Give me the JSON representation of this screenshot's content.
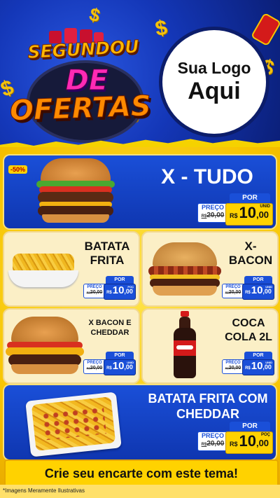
{
  "header": {
    "title_line1": "SEGUNDOU",
    "title_line2": "DE",
    "title_line3": "OFERTAS",
    "logo_line1": "Sua Logo",
    "logo_line2": "Aqui",
    "dollar_symbol": "$"
  },
  "products": [
    {
      "name": "X - TUDO",
      "badge": "-50%",
      "por": "POR",
      "preco_label": "PREÇO",
      "old_currency": "R$",
      "old_price": "20,00",
      "currency": "R$",
      "price_int": "10",
      "price_dec": ",00",
      "unit": "UNID"
    },
    {
      "name": "BATATA FRITA",
      "por": "POR",
      "preco_label": "PREÇO",
      "old_currency": "R$",
      "old_price": "20,00",
      "currency": "R$",
      "price_int": "10",
      "price_dec": ",00",
      "unit": "POÇ"
    },
    {
      "name": "X-BACON",
      "por": "POR",
      "preco_label": "PREÇO",
      "old_currency": "R$",
      "old_price": "20,00",
      "currency": "R$",
      "price_int": "10",
      "price_dec": ",00",
      "unit": "UNID"
    },
    {
      "name": "X BACON E CHEDDAR",
      "por": "POR",
      "preco_label": "PREÇO",
      "old_currency": "R$",
      "old_price": "20,00",
      "currency": "R$",
      "price_int": "10",
      "price_dec": ",00",
      "unit": "UNID"
    },
    {
      "name": "COCA COLA 2L",
      "por": "POR",
      "preco_label": "PREÇO",
      "old_currency": "R$",
      "old_price": "20,00",
      "currency": "R$",
      "price_int": "10",
      "price_dec": ",00",
      "unit": "UNID"
    },
    {
      "name": "BATATA FRITA COM CHEDDAR",
      "por": "POR",
      "preco_label": "PREÇO",
      "old_currency": "R$",
      "old_price": "20,00",
      "currency": "R$",
      "price_int": "10",
      "price_dec": ",00",
      "unit": "POÇ"
    }
  ],
  "cta": "Crie seu encarte com este tema!",
  "footer_note": "*Imagens Meramente Ilustrativas",
  "colors": {
    "blue": "#1a4fd8",
    "yellow": "#ffd200",
    "cream": "#fbefc6",
    "dark_blue": "#0d2a8a"
  }
}
